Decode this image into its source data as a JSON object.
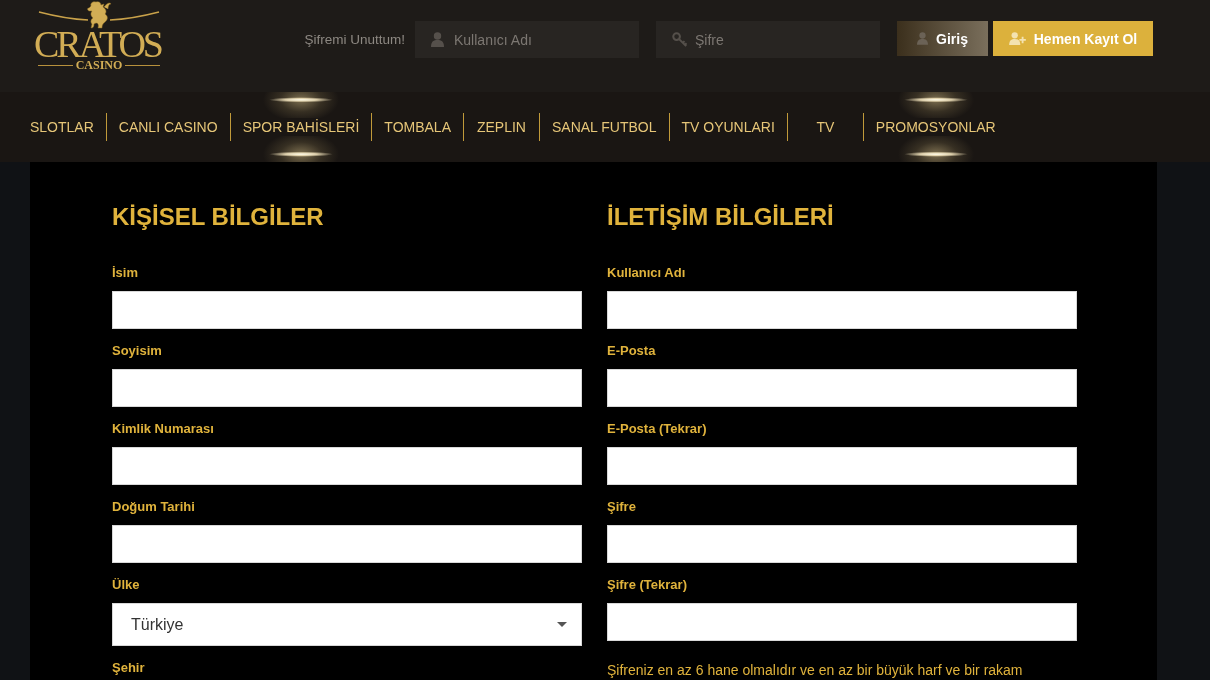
{
  "header": {
    "logo": {
      "wordmark": "CRATOS",
      "subtitle": "CASINO"
    },
    "forgot_password_link": "Şifremi Unuttum!",
    "username_field": {
      "placeholder": "Kullanıcı Adı"
    },
    "password_field": {
      "placeholder": "Şifre"
    },
    "login_button": "Giriş",
    "register_button": "Hemen Kayıt Ol"
  },
  "nav": {
    "items": [
      {
        "label": "SLOTLAR",
        "highlighted": false
      },
      {
        "label": "CANLI CASINO",
        "highlighted": false
      },
      {
        "label": "SPOR BAHİSLERİ",
        "highlighted": true
      },
      {
        "label": "TOMBALA",
        "highlighted": false
      },
      {
        "label": "ZEPLIN",
        "highlighted": false
      },
      {
        "label": "SANAL FUTBOL",
        "highlighted": false
      },
      {
        "label": "TV OYUNLARI",
        "highlighted": false
      },
      {
        "label": "TV",
        "highlighted": false
      },
      {
        "label": "PROMOSYONLAR",
        "highlighted": true
      }
    ]
  },
  "form": {
    "sections": [
      {
        "title": "KİŞİSEL BİLGİLER",
        "fields": [
          {
            "label": "İsim",
            "kind": "text"
          },
          {
            "label": "Soyisim",
            "kind": "text"
          },
          {
            "label": "Kimlik Numarası",
            "kind": "text"
          },
          {
            "label": "Doğum Tarihi",
            "kind": "text"
          },
          {
            "label": "Ülke",
            "kind": "select",
            "value": "Türkiye"
          },
          {
            "label": "Şehir",
            "kind": "label"
          }
        ]
      },
      {
        "title": "İLETİŞİM BİLGİLERİ",
        "fields": [
          {
            "label": "Kullanıcı Adı",
            "kind": "text"
          },
          {
            "label": "E-Posta",
            "kind": "text"
          },
          {
            "label": "E-Posta (Tekrar)",
            "kind": "text"
          },
          {
            "label": "Şifre",
            "kind": "text"
          },
          {
            "label": "Şifre (Tekrar)",
            "kind": "text"
          }
        ],
        "note": "Şifreniz en az 6 hane olmalıdır ve en az bir büyük harf ve bir rakam"
      }
    ]
  }
}
